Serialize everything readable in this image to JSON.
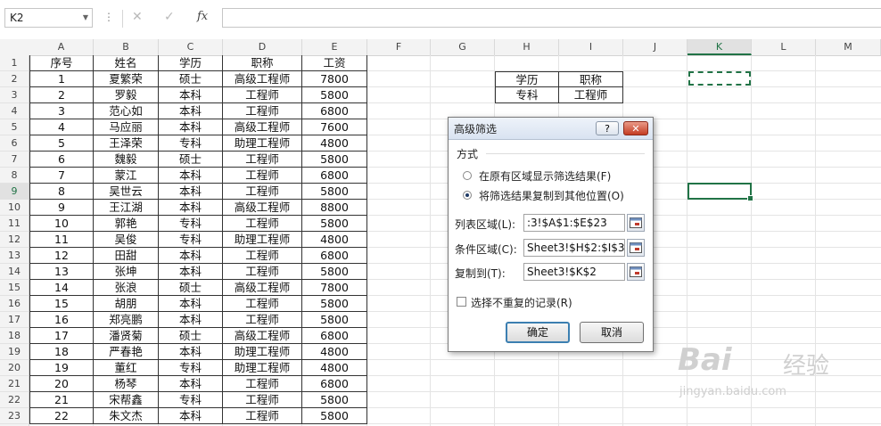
{
  "formula_bar": {
    "name_box": "K2",
    "fx_label": "fx",
    "formula": ""
  },
  "columns": [
    "A",
    "B",
    "C",
    "D",
    "E",
    "F",
    "G",
    "H",
    "I",
    "J",
    "K",
    "L",
    "M"
  ],
  "selected_column": "K",
  "row_numbers": [
    "1",
    "2",
    "3",
    "4",
    "5",
    "6",
    "7",
    "8",
    "9",
    "10",
    "11",
    "12",
    "13",
    "14",
    "15",
    "16",
    "17",
    "18",
    "19",
    "20",
    "21",
    "22",
    "23"
  ],
  "selected_row": "9",
  "table": {
    "headers": [
      "序号",
      "姓名",
      "学历",
      "职称",
      "工资"
    ],
    "rows": [
      [
        "1",
        "夏繁荣",
        "硕士",
        "高级工程师",
        "7800"
      ],
      [
        "2",
        "罗毅",
        "本科",
        "工程师",
        "5800"
      ],
      [
        "3",
        "范心如",
        "本科",
        "工程师",
        "6800"
      ],
      [
        "4",
        "马应丽",
        "本科",
        "高级工程师",
        "7600"
      ],
      [
        "5",
        "王泽荣",
        "专科",
        "助理工程师",
        "4800"
      ],
      [
        "6",
        "魏毅",
        "硕士",
        "工程师",
        "5800"
      ],
      [
        "7",
        "蒙江",
        "本科",
        "工程师",
        "6800"
      ],
      [
        "8",
        "吴世云",
        "本科",
        "工程师",
        "5800"
      ],
      [
        "9",
        "王江湖",
        "本科",
        "高级工程师",
        "8800"
      ],
      [
        "10",
        "郭艳",
        "专科",
        "工程师",
        "5800"
      ],
      [
        "11",
        "吴俊",
        "专科",
        "助理工程师",
        "4800"
      ],
      [
        "12",
        "田甜",
        "本科",
        "工程师",
        "6800"
      ],
      [
        "13",
        "张坤",
        "本科",
        "工程师",
        "5800"
      ],
      [
        "14",
        "张浪",
        "硕士",
        "高级工程师",
        "7800"
      ],
      [
        "15",
        "胡朋",
        "本科",
        "工程师",
        "5800"
      ],
      [
        "16",
        "郑亮鹏",
        "本科",
        "工程师",
        "5800"
      ],
      [
        "17",
        "潘贤菊",
        "硕士",
        "高级工程师",
        "6800"
      ],
      [
        "18",
        "严春艳",
        "本科",
        "助理工程师",
        "4800"
      ],
      [
        "19",
        "董红",
        "专科",
        "助理工程师",
        "4800"
      ],
      [
        "20",
        "杨琴",
        "本科",
        "工程师",
        "6800"
      ],
      [
        "21",
        "宋帮鑫",
        "专科",
        "工程师",
        "5800"
      ],
      [
        "22",
        "朱文杰",
        "本科",
        "工程师",
        "5800"
      ]
    ]
  },
  "criteria": {
    "headers": [
      "学历",
      "职称"
    ],
    "values": [
      "专科",
      "工程师"
    ]
  },
  "dialog": {
    "title": "高级筛选",
    "help": "?",
    "group_label": "方式",
    "option_inplace": "在原有区域显示筛选结果(F)",
    "option_copy": "将筛选结果复制到其他位置(O)",
    "list_range_label": "列表区域(L):",
    "list_range_value": ":3!$A$1:$E$23",
    "criteria_range_label": "条件区域(C):",
    "criteria_range_value": "Sheet3!$H$2:$I$3",
    "copy_to_label": "复制到(T):",
    "copy_to_value": "Sheet3!$K$2",
    "unique_label": "选择不重复的记录(R)",
    "ok": "确定",
    "cancel": "取消"
  },
  "watermark": {
    "brand": "Bai",
    "brand_cn": "经验",
    "url": "jingyan.baidu.com"
  }
}
